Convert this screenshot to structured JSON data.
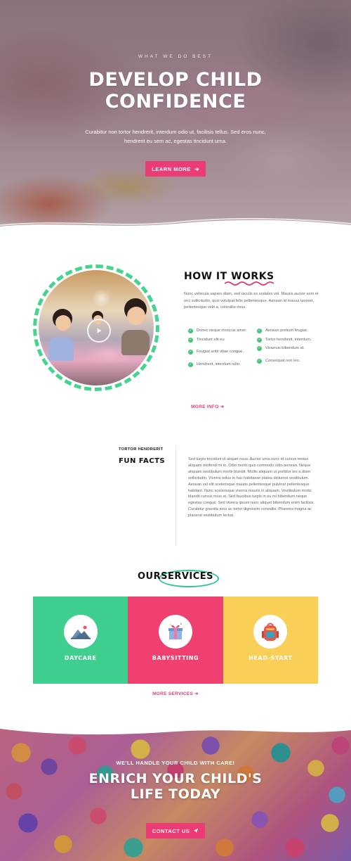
{
  "colors": {
    "accent_pink": "#ec3c76",
    "green": "#46d38f",
    "services_green": "#3ecf8e",
    "services_pink": "#f0406f",
    "services_yellow": "#f9cf57"
  },
  "hero": {
    "eyebrow": "WHAT WE DO BEST",
    "title_line1": "DEVELOP CHILD",
    "title_line2": "CONFIDENCE",
    "subtitle": "Curabitur non tortor hendrerit, interdum odio ut, facilisis tellus. Sed eros nunc, hendrerit eu sem ac, egestas tincidunt urna.",
    "button_label": "LEARN MORE",
    "button_icon": "arrow-right-icon"
  },
  "how_it_works": {
    "title": "HOW IT WORKS",
    "text": "Nunc vehicula sapien diam, sed iaculis ex sodales vel. Mauris auctor sem et orci sollicitudin, quis volutpat felis pellentesque. Aenean id massa laoreet, pellentesque velit a, convallis risus.",
    "checklist_left": [
      "Donec neque rhoncus amet.",
      "Tincidunt elit eu",
      "Feugiat ante vitae congue.",
      "Hendrerit, interdum odio"
    ],
    "checklist_right": [
      "Aenean pretium feugiat.",
      "Tortor hendrerit, interdum.",
      "Vivamus bibendum id.",
      "Consequat non leo."
    ],
    "more_link": "MORE INFO"
  },
  "fun_facts": {
    "eyebrow": "TORTOR HENDRERIT",
    "title": "FUN FACTS",
    "text": "Sed turpis tincidunt id aliquet risus. Auctor urna nunc id cursus metus aliquam eleifend mi in. Odio morbi quis commodo odio aenean. Neque aliquam vestibulum morbi blandit. Mollis aliquam ut porttitor leo a diam sollicitudin. Viverra tellus in hac habitasse platea dictumst vestibulum. Aenean vel elit scelerisque mauris pellentesque pulvinar pellentesque habitant. Nunc scelerisque viverra mauris in aliquam. Vestibulum morbi blandit cursus risus at. Sed faucibus turpis in eu mi bibendum neque egestas congue. Sed viverra ipsum nunc aliquet bibendum enim facilisis. Curabitur gravida arcu ac tortor dignissim convallis. Pharetra magna ac placerat vestibulum lectus."
  },
  "services": {
    "title_plain": "OUR",
    "title_circled": "SERVICES",
    "items": [
      {
        "label": "DAYCARE",
        "icon": "mountains-icon",
        "color": "#3ecf8e"
      },
      {
        "label": "BABYSITTING",
        "icon": "gift-icon",
        "color": "#f0406f"
      },
      {
        "label": "HEAD-START",
        "icon": "backpack-icon",
        "color": "#f9cf57"
      }
    ],
    "more_link": "MORE SERVICES"
  },
  "cta": {
    "eyebrow": "WE'LL HANDLE YOUR CHILD WITH CARE!",
    "title_line1": "ENRICH YOUR CHILD'S",
    "title_line2": "LIFE TODAY",
    "button_label": "CONTACT US",
    "button_icon": "paper-plane-icon"
  }
}
